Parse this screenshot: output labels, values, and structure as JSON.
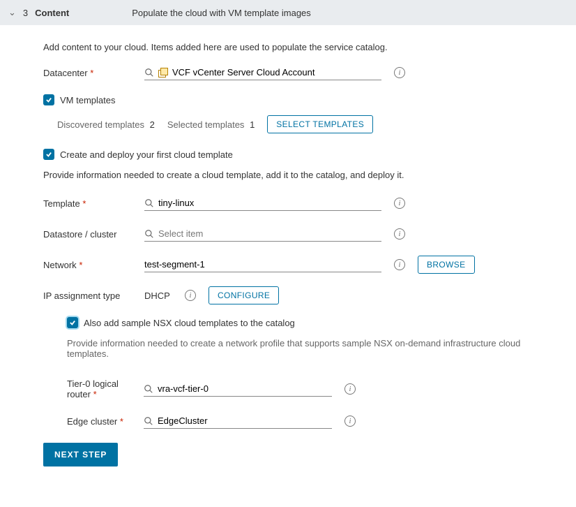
{
  "header": {
    "step_num": "3",
    "step_title": "Content",
    "subtitle": "Populate the cloud with VM template images"
  },
  "intro": "Add content to your cloud. Items added here are used to populate the service catalog.",
  "datacenter": {
    "label": "Datacenter",
    "value": "VCF vCenter Server Cloud Account"
  },
  "vm_templates": {
    "label": "VM templates",
    "discovered_label": "Discovered templates",
    "discovered_val": "2",
    "selected_label": "Selected templates",
    "selected_val": "1",
    "select_btn": "SELECT TEMPLATES"
  },
  "deploy": {
    "label": "Create and deploy your first cloud template",
    "desc": "Provide information needed to create a cloud template, add it to the catalog, and deploy it."
  },
  "template": {
    "label": "Template",
    "value": "tiny-linux"
  },
  "datastore": {
    "label": "Datastore / cluster",
    "placeholder": "Select item"
  },
  "network": {
    "label": "Network",
    "value": "test-segment-1",
    "browse": "BROWSE"
  },
  "ip": {
    "label": "IP assignment type",
    "value": "DHCP",
    "configure": "CONFIGURE"
  },
  "nsx": {
    "label": "Also add sample NSX cloud templates to the catalog",
    "desc": "Provide information needed to create a network profile that supports sample NSX on-demand infrastructure cloud templates.",
    "tier0": {
      "label": "Tier-0 logical router",
      "value": "vra-vcf-tier-0"
    },
    "edge": {
      "label": "Edge cluster",
      "value": "EdgeCluster"
    }
  },
  "next": "NEXT STEP"
}
